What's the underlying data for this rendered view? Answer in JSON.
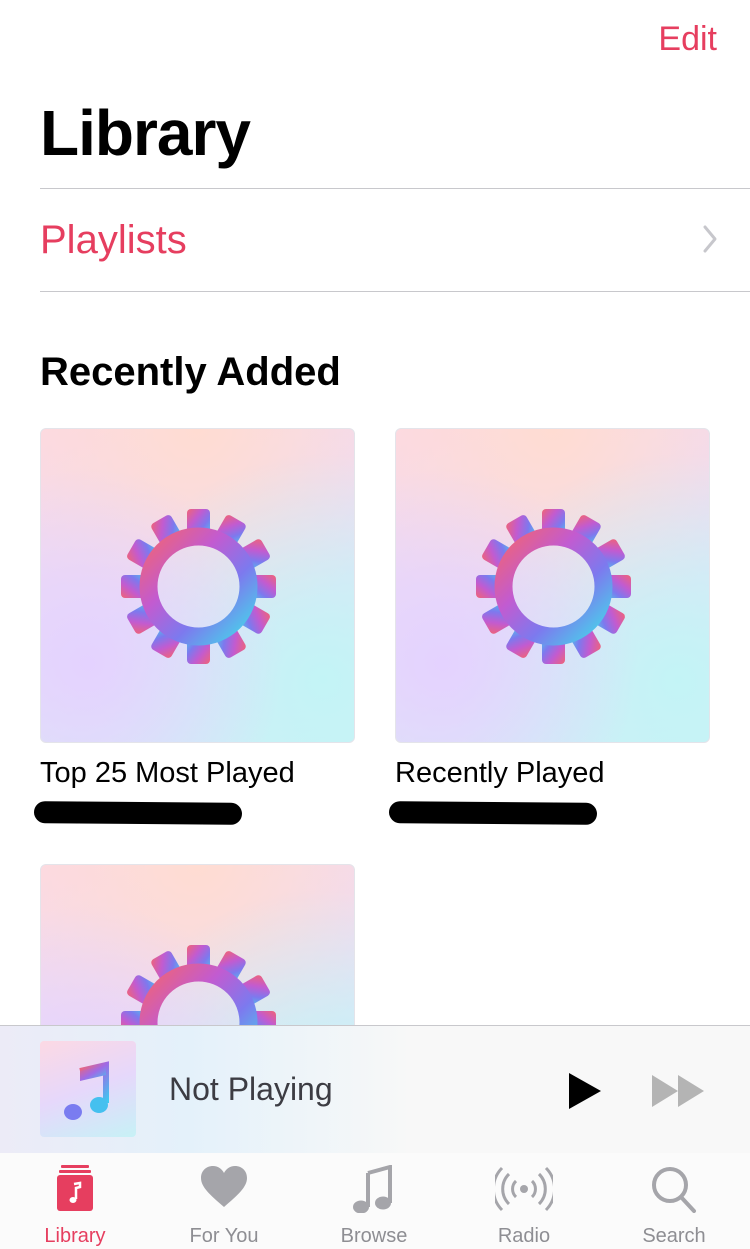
{
  "nav": {
    "edit_label": "Edit",
    "title": "Library"
  },
  "library_rows": [
    {
      "label": "Playlists"
    }
  ],
  "recently_added": {
    "heading": "Recently Added",
    "items": [
      {
        "title": "Top 25 Most Played",
        "subtitle_redacted": true
      },
      {
        "title": "Recently Played",
        "subtitle_redacted": true
      },
      {
        "title": "",
        "subtitle_redacted": false
      }
    ]
  },
  "mini_player": {
    "status": "Not Playing",
    "play_icon": "play-icon",
    "forward_icon": "fast-forward-icon"
  },
  "tab_bar": {
    "active": "Library",
    "tabs": [
      {
        "label": "Library",
        "icon": "library-icon"
      },
      {
        "label": "For You",
        "icon": "heart-icon"
      },
      {
        "label": "Browse",
        "icon": "music-note-icon"
      },
      {
        "label": "Radio",
        "icon": "radio-icon"
      },
      {
        "label": "Search",
        "icon": "search-icon"
      }
    ]
  },
  "colors": {
    "accent": "#e63e5f",
    "inactive": "#8e8e93"
  }
}
